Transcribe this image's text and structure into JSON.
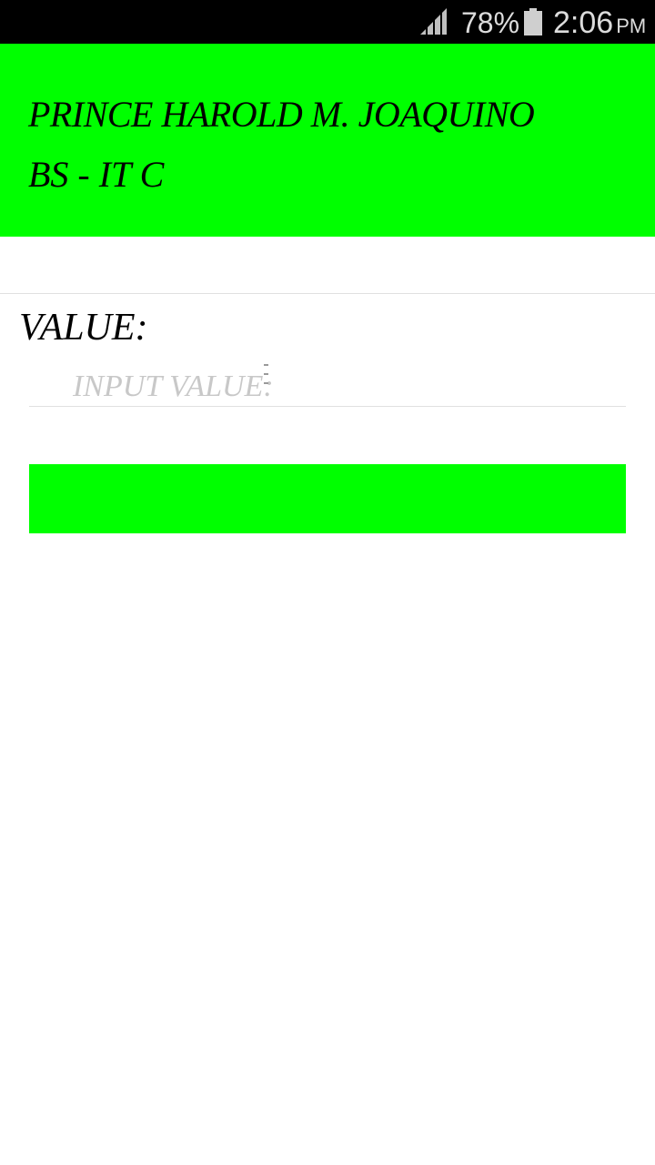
{
  "status_bar": {
    "signal_icon": "cellular-signal-icon",
    "battery_percent": "78%",
    "battery_icon": "battery-icon",
    "time": "2:06",
    "ampm": "PM"
  },
  "header": {
    "name": "PRINCE HAROLD M. JOAQUINO",
    "course": "BS - IT C",
    "background_color": "#00ff00"
  },
  "form": {
    "value_label": "VALUE:",
    "input_placeholder": "INPUT VALUE:",
    "input_value": "",
    "button_label": "",
    "button_color": "#00ff00"
  }
}
